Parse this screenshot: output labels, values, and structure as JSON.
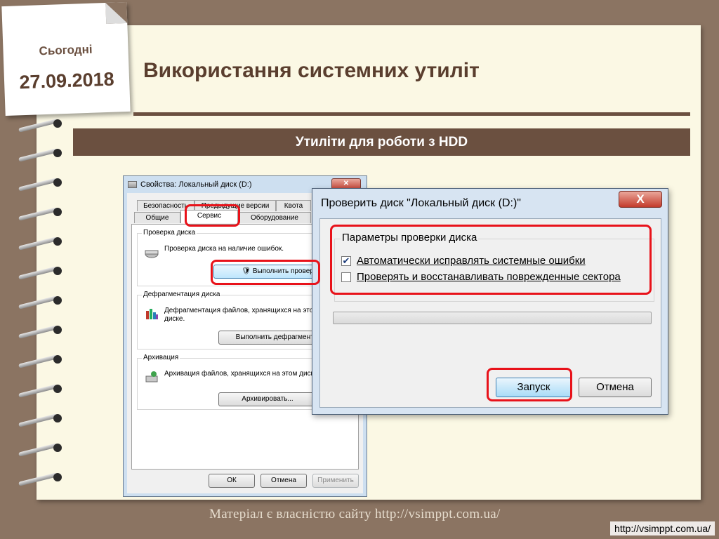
{
  "note": {
    "label": "Сьогодні",
    "date": "27.09.2018"
  },
  "slide": {
    "title": "Використання системних утиліт",
    "banner": "Утиліти для роботи з HDD"
  },
  "properties_window": {
    "title": "Свойства: Локальный диск (D:)",
    "tabs_top": [
      "Безопасность",
      "Предыдущие версии",
      "Квота"
    ],
    "tabs_bottom": [
      "Общие",
      "Сервис",
      "Оборудование"
    ],
    "active_tab": "Сервис",
    "groups": [
      {
        "title": "Проверка диска",
        "text": "Проверка диска на наличие ошибок.",
        "button": "Выполнить проверку..."
      },
      {
        "title": "Дефрагментация диска",
        "text": "Дефрагментация файлов, хранящихся на этом диске.",
        "button": "Выполнить дефрагментацию..."
      },
      {
        "title": "Архивация",
        "text": "Архивация файлов, хранящихся на этом диске.",
        "button": "Архивировать..."
      }
    ],
    "buttons": {
      "ok": "ОК",
      "cancel": "Отмена",
      "apply": "Применить"
    }
  },
  "check_disk_dialog": {
    "title": "Проверить диск \"Локальный диск (D:)\"",
    "close_label": "X",
    "options_title": "Параметры проверки диска",
    "options": [
      {
        "label": "Автоматически исправлять системные ошибки",
        "checked": true
      },
      {
        "label": "Проверять и восстанавливать поврежденные сектора",
        "checked": false
      }
    ],
    "progress": 0,
    "start_button": "Запуск",
    "cancel_button": "Отмена"
  },
  "footer": {
    "note": "Матеріал є власністю сайту http://vsimppt.com.ua/",
    "url": "http://vsimppt.com.ua/"
  },
  "colors": {
    "accent": "#6b5040",
    "highlight": "#e8121a",
    "paper": "#fbf8e4",
    "background": "#8b7462"
  }
}
